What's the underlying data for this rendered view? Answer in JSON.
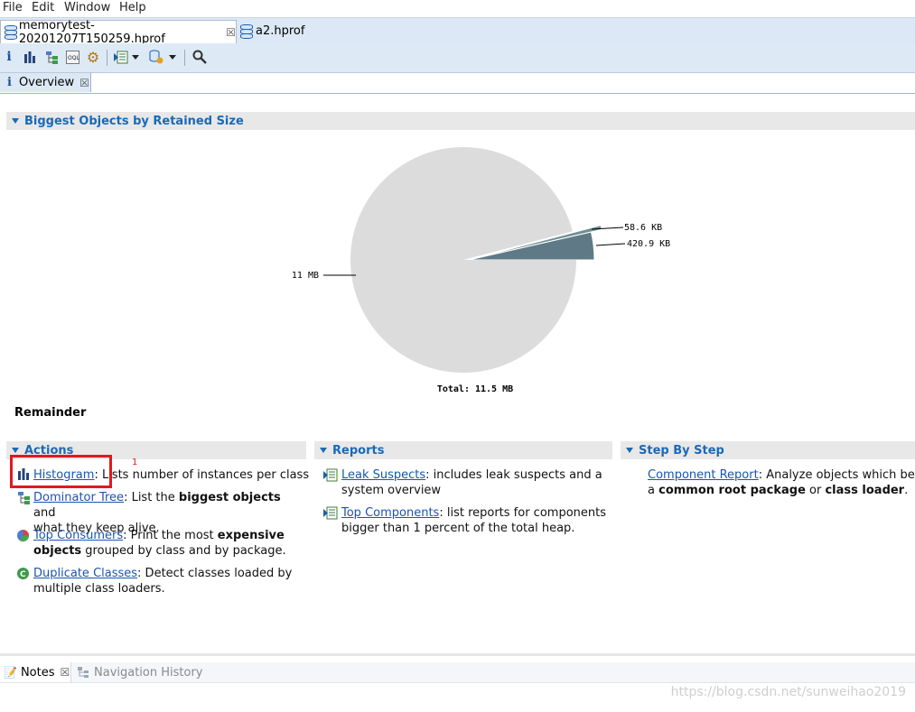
{
  "menu": [
    "File",
    "Edit",
    "Window",
    "Help"
  ],
  "editor_tabs": [
    {
      "label": "memorytest-20201207T150259.hprof",
      "active": true,
      "closable": true
    },
    {
      "label": "a2.hprof",
      "active": false,
      "closable": false
    }
  ],
  "toolbar": {
    "icons": [
      "info-icon",
      "histogram-icon",
      "dominator-tree-icon",
      "oql-icon",
      "gear-icon",
      "report-icon",
      "dropdown-icon",
      "query-icon",
      "dropdown-icon",
      "search-icon"
    ]
  },
  "view_tab": {
    "label": "Overview",
    "close": "☒"
  },
  "biggest_objects": {
    "header": "Biggest Objects by Retained Size",
    "remainder_label": "Remainder",
    "chart_total": "Total: 11.5 MB"
  },
  "chart_data": {
    "type": "pie",
    "total_label": "Total: 11.5 MB",
    "slices": [
      {
        "label": "11 MB",
        "value_kb": 11264,
        "color": "#dcdcdc"
      },
      {
        "label": "58.6 KB",
        "value_kb": 58.6,
        "color": "#6f8f96"
      },
      {
        "label": "420.9 KB",
        "value_kb": 420.9,
        "color": "#5f7a86"
      }
    ]
  },
  "actions": {
    "header": "Actions",
    "annotation_number": "1",
    "items": [
      {
        "link": "Histogram",
        "text": ": Lists number of instances per class"
      },
      {
        "link": "Dominator Tree",
        "text_a": ": List the ",
        "bold": "biggest objects",
        "text_b": " and",
        "line2": "what they keep alive."
      },
      {
        "link": "Top Consumers",
        "text_a": ": Print the most ",
        "bold": "expensive",
        "line2_bold": "objects",
        "line2": " grouped by class and by package."
      },
      {
        "link": "Duplicate Classes",
        "text": ": Detect classes loaded by",
        "line2": "multiple class loaders."
      }
    ]
  },
  "reports": {
    "header": "Reports",
    "items": [
      {
        "link": "Leak Suspects",
        "text": ": includes leak suspects and a",
        "line2": "system overview"
      },
      {
        "link": "Top Components",
        "text": ": list reports for components",
        "line2": "bigger than 1 percent of the total heap."
      }
    ]
  },
  "step_by_step": {
    "header": "Step By Step",
    "items": [
      {
        "link": "Component Report",
        "text": ": Analyze objects which belong t",
        "line2_a": "a ",
        "line2_bold1": "common root package",
        "line2_b": " or ",
        "line2_bold2": "class loader",
        "line2_c": "."
      }
    ]
  },
  "bottom_tabs": [
    {
      "label": "Notes",
      "close": "☒"
    },
    {
      "label": "Navigation History"
    }
  ],
  "watermark": "https://blog.csdn.net/sunweihao2019"
}
